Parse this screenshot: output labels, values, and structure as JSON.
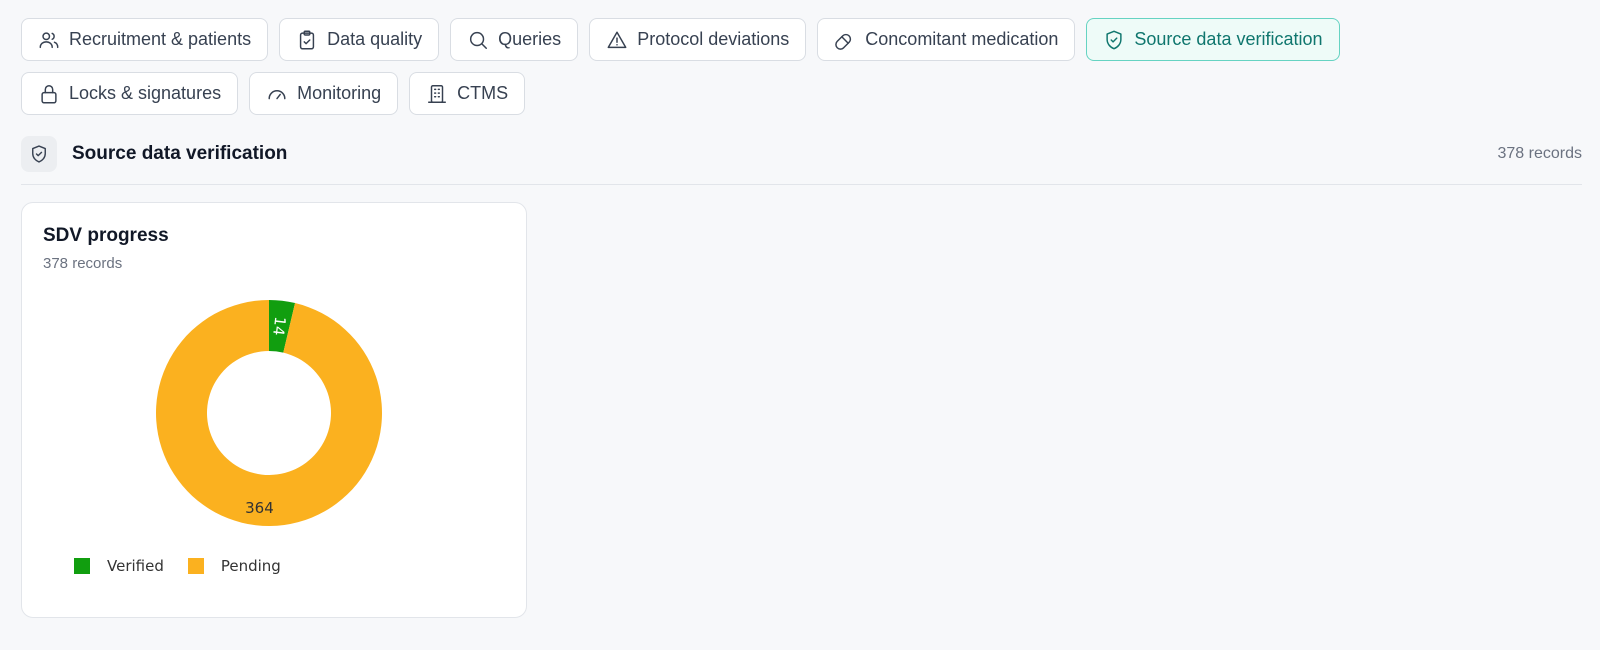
{
  "tabs": [
    {
      "label": "Recruitment & patients",
      "icon": "users-icon",
      "active": false
    },
    {
      "label": "Data quality",
      "icon": "clipboard-check-icon",
      "active": false
    },
    {
      "label": "Queries",
      "icon": "search-icon",
      "active": false
    },
    {
      "label": "Protocol deviations",
      "icon": "alert-triangle-icon",
      "active": false
    },
    {
      "label": "Concomitant medication",
      "icon": "pill-icon",
      "active": false
    },
    {
      "label": "Source data verification",
      "icon": "shield-check-icon",
      "active": true
    },
    {
      "label": "Locks & signatures",
      "icon": "lock-icon",
      "active": false
    },
    {
      "label": "Monitoring",
      "icon": "gauge-icon",
      "active": false
    },
    {
      "label": "CTMS",
      "icon": "building-icon",
      "active": false
    }
  ],
  "section": {
    "title": "Source data verification",
    "count": "378 records",
    "icon": "shield-check-icon"
  },
  "card": {
    "title": "SDV progress",
    "subtitle": "378 records"
  },
  "colors": {
    "verified": "#119e0f",
    "pending": "#fbb11f",
    "accent": "#0f766e"
  },
  "chart_data": {
    "type": "pie",
    "variant": "donut",
    "categories": [
      "Verified",
      "Pending"
    ],
    "values": [
      14,
      364
    ],
    "colors": [
      "#119e0f",
      "#fbb11f"
    ],
    "legend": "bottom-left"
  }
}
